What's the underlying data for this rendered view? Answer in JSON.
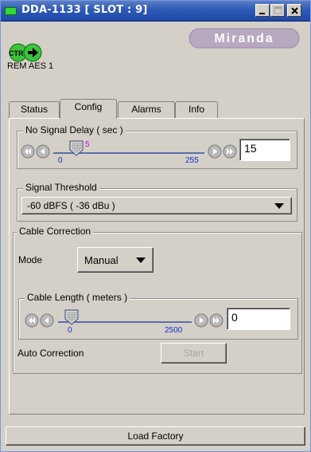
{
  "window": {
    "title": "DDA-1133 [ SLOT : 9]",
    "minimize_icon": "minimize-icon",
    "maximize_icon": "maximize-icon",
    "close_icon": "close-icon"
  },
  "header": {
    "ctrl_icon_label": "CTRL",
    "status_text": "REM AES 1",
    "logo_text": "Miranda"
  },
  "tabs": [
    {
      "label": "Status",
      "active": false
    },
    {
      "label": "Config",
      "active": true
    },
    {
      "label": "Alarms",
      "active": false
    },
    {
      "label": "Info",
      "active": false
    }
  ],
  "no_signal_delay": {
    "label": "No Signal Delay ( sec )",
    "min": "0",
    "max": "255",
    "thumb_value": "5",
    "value": "15",
    "fraction": 0.02
  },
  "signal_threshold": {
    "label": "Signal Threshold",
    "selected": "-60 dBFS ( -36 dBu )"
  },
  "cable_correction": {
    "label": "Cable Correction",
    "mode_label": "Mode",
    "mode_selected": "Manual",
    "cable_length": {
      "label": "Cable Length ( meters )",
      "min": "0",
      "max": "2500",
      "value": "0",
      "fraction": 0.0
    },
    "auto_correction_label": "Auto Correction",
    "start_label": "Start"
  },
  "footer": {
    "load_factory_label": "Load Factory"
  },
  "colors": {
    "titlebar": "#2d59b7",
    "accent_blue": "#1030c8",
    "accent_pink": "#e000e0",
    "led_green": "#35d635"
  }
}
